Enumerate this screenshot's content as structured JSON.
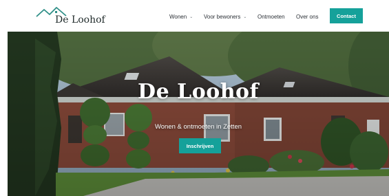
{
  "header": {
    "logo_text": "De Loohof",
    "nav": {
      "wonen": "Wonen",
      "voor_bewoners": "Voor bewoners",
      "ontmoeten": "Ontmoeten",
      "over_ons": "Over ons"
    },
    "contact_label": "Contact"
  },
  "hero": {
    "title": "De Loohof",
    "subtitle": "Wonen & ontmoeten in Zetten",
    "cta_label": "Inschrijven"
  },
  "colors": {
    "accent": "#15a19a",
    "logo_roof": "#2f8f87",
    "text_dark": "#1f2a2a"
  },
  "icons": {
    "logo": "house-roof-icon",
    "dropdown": "chevron-down-icon"
  }
}
